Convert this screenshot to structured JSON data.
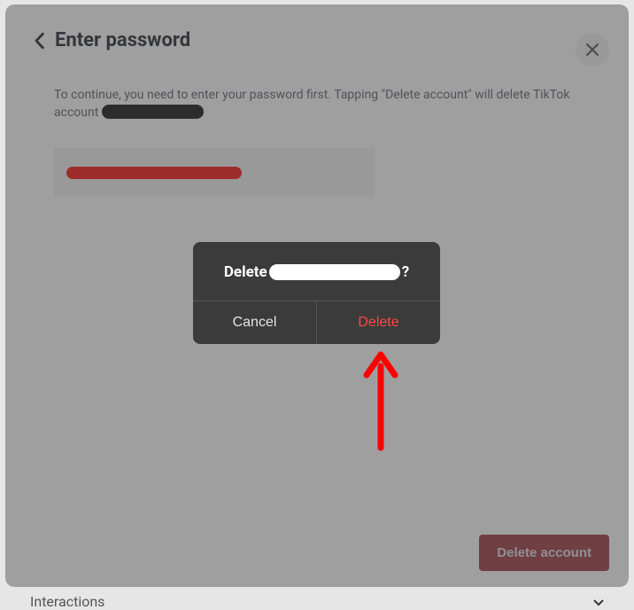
{
  "header": {
    "title": "Enter password"
  },
  "content": {
    "description_prefix": "To continue, you need to enter your password first. Tapping \"Delete account\" will delete TikTok account"
  },
  "delete_button": {
    "label": "Delete account"
  },
  "confirm_dialog": {
    "title_prefix": "Delete",
    "title_suffix": "?",
    "cancel_label": "Cancel",
    "delete_label": "Delete"
  },
  "bottom": {
    "label": "Interactions"
  }
}
